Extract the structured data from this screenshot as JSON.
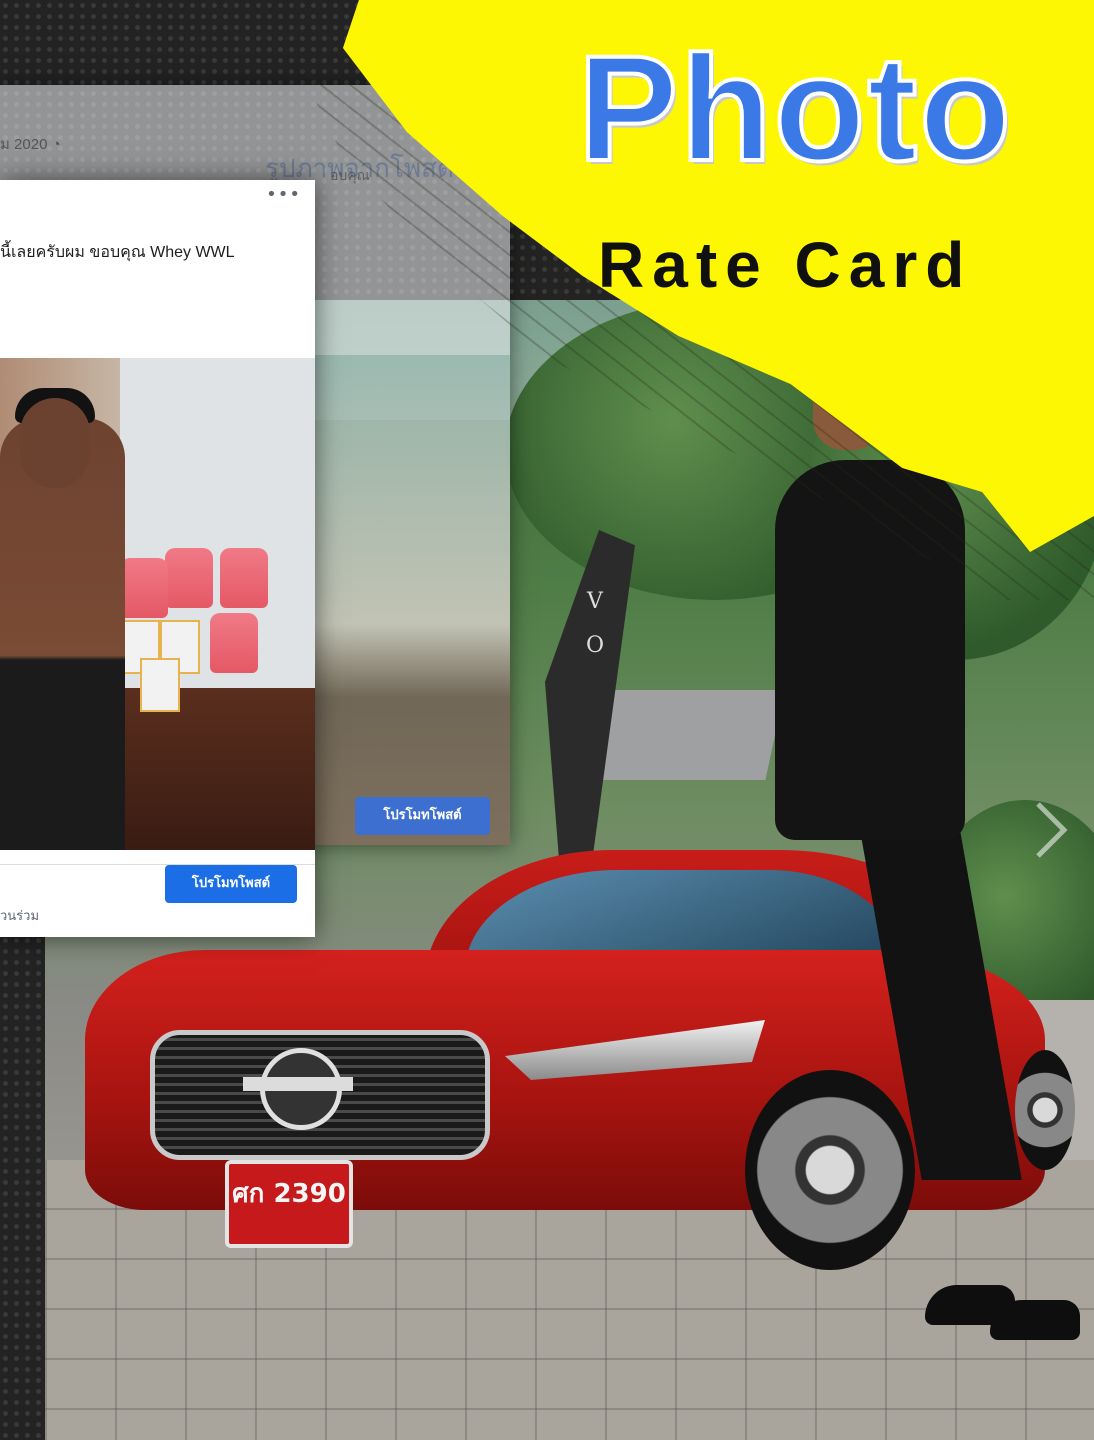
{
  "banner": {
    "title": "Photo",
    "subtitle": "Rate Card",
    "title_color": "#3b79e6",
    "banner_color": "#fdf703"
  },
  "fb_post_back": {
    "date_text": "ม 2020",
    "ghost_title": "รูปภาพจากโพสต์ขอ",
    "ghost_caption": "อบคุณ",
    "promote_button": "โปรโมทโพสต์"
  },
  "fb_post_front": {
    "menu_icon": "more-options-icon",
    "caption": "นี้เลยครับผม ขอบคุณ Whey WWL",
    "footer_text": "วนร่วม",
    "promote_button": "โปรโมทโพสต์"
  },
  "scene": {
    "flag_text": "V O",
    "plate_text": "ศก 2390",
    "accent_car_color": "#c81d19"
  }
}
